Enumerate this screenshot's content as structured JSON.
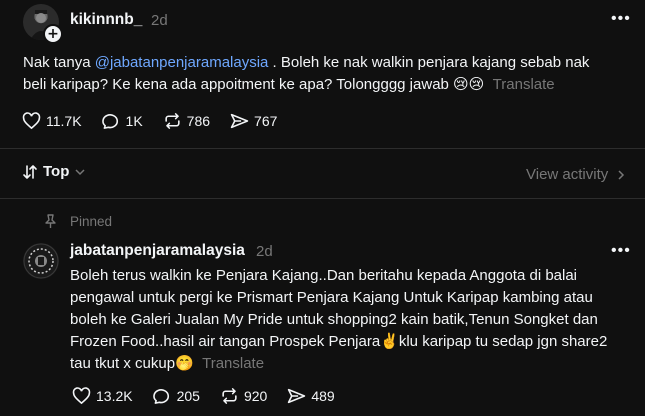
{
  "post": {
    "username": "kikinnnb_",
    "time": "2d",
    "text_before": "Nak tanya ",
    "mention": "@jabatanpenjaramalaysia",
    "text_after": " . Boleh ke nak walkin penjara kajang sebab nak beli karipap? Ke kena ada appoitment ke apa? Tolongggg jawab 😢😢",
    "translate": "Translate",
    "likes": "11.7K",
    "replies": "1K",
    "reposts": "786",
    "shares": "767"
  },
  "sort": {
    "label": "Top"
  },
  "view_activity": "View activity",
  "reply": {
    "pinned_label": "Pinned",
    "username": "jabatanpenjaramalaysia",
    "time": "2d",
    "line1": "Boleh terus walkin ke Penjara Kajang..Dan beritahu kepada Anggota di balai",
    "line2": "pengawal untuk pergi ke Prismart Penjara Kajang Untuk Karipap kambing atau",
    "line3": "boleh ke Galeri Jualan My Pride untuk shopping2 kain batik,Tenun Songket dan",
    "line4": "Frozen Food..hasil air tangan Prospek Penjara✌️klu karipap tu sedap jgn share2",
    "line5": "tau tkut x cukup🤭",
    "translate": "Translate",
    "likes": "13.2K",
    "replies": "205",
    "reposts": "920",
    "shares": "489"
  }
}
